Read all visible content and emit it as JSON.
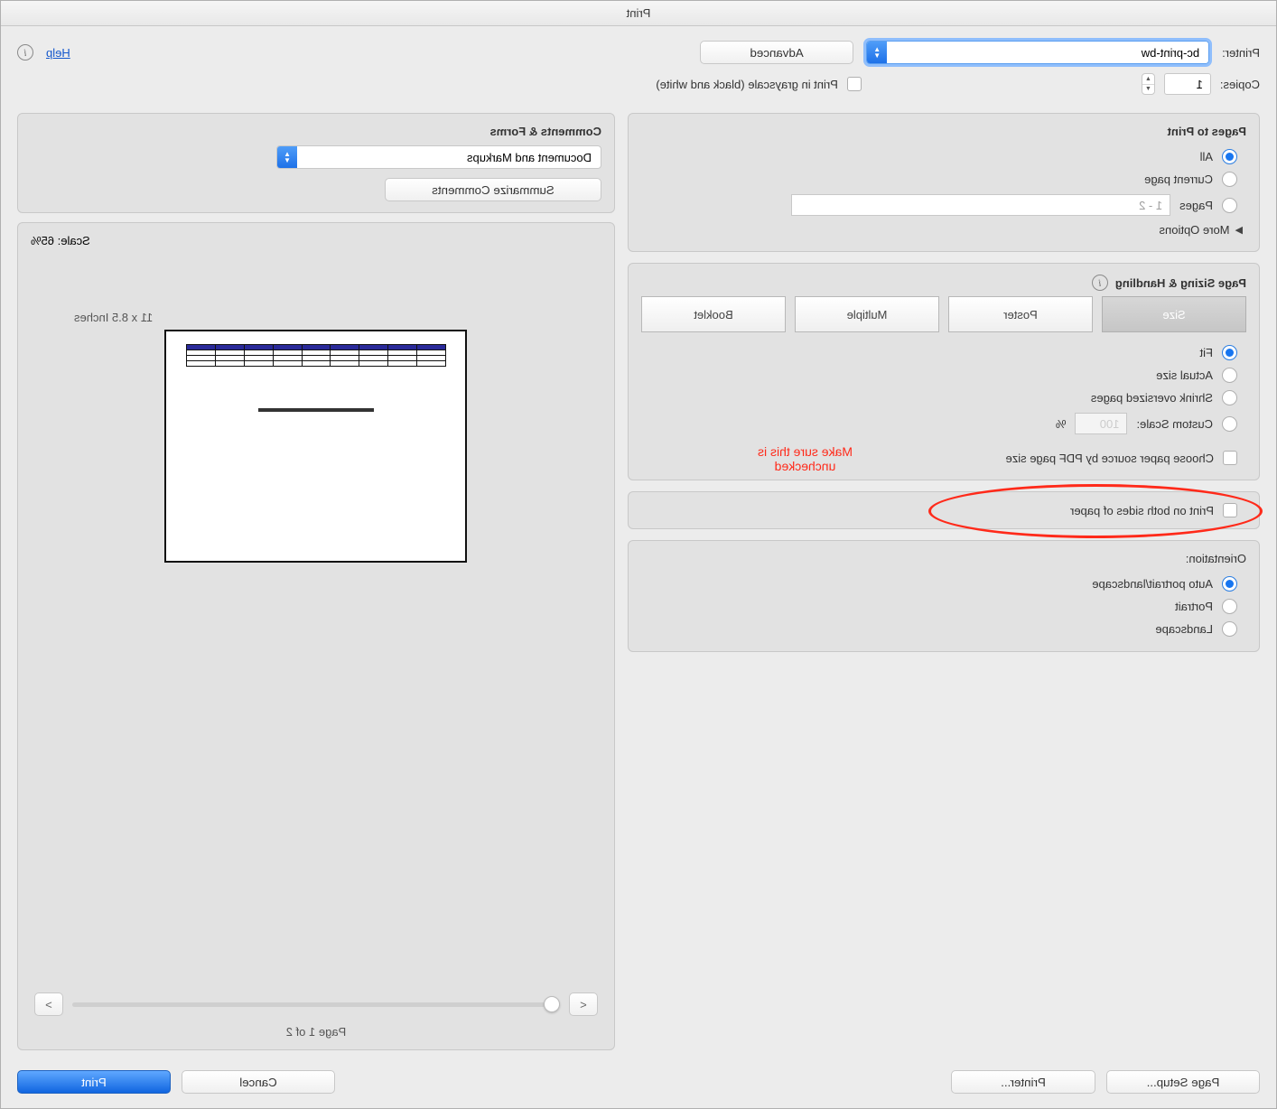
{
  "window": {
    "title": "Print"
  },
  "topbar": {
    "printer_label": "Printer:",
    "printer_value": "bc-print-bw",
    "advanced_button": "Advanced",
    "help_link": "Help",
    "copies_label": "Copies:",
    "copies_value": "1",
    "grayscale_label": "Print in grayscale (black and white)"
  },
  "pages_to_print": {
    "heading": "Pages to Print",
    "all": "All",
    "current": "Current page",
    "pages": "Pages",
    "pages_range_placeholder": "1 - 2",
    "more_options": "More Options"
  },
  "sizing": {
    "heading": "Page Sizing & Handling",
    "tabs": {
      "size": "Size",
      "poster": "Poster",
      "multiple": "Multiple",
      "booklet": "Booklet"
    },
    "fit": "Fit",
    "actual": "Actual size",
    "shrink": "Shrink oversized pages",
    "custom": "Custom Scale:",
    "custom_value": "100",
    "percent": "%",
    "choose_paper": "Choose paper source by PDF page size",
    "both_sides": "Print on both sides of paper"
  },
  "orientation": {
    "heading": "Orientation:",
    "auto": "Auto portrait/landscape",
    "portrait": "Portrait",
    "landscape": "Landscape"
  },
  "comments": {
    "heading": "Comments & Forms",
    "value": "Document and Markups",
    "summarize": "Summarize Comments"
  },
  "preview": {
    "scale_label": "Scale:  65%",
    "dimensions": "11 x 8.5 Inches",
    "page_of": "Page 1 of 2"
  },
  "annotation": {
    "line1": "Make sure this is",
    "line2": "unchecked"
  },
  "footer": {
    "page_setup": "Page Setup...",
    "printer": "Printer...",
    "cancel": "Cancel",
    "print": "Print"
  }
}
